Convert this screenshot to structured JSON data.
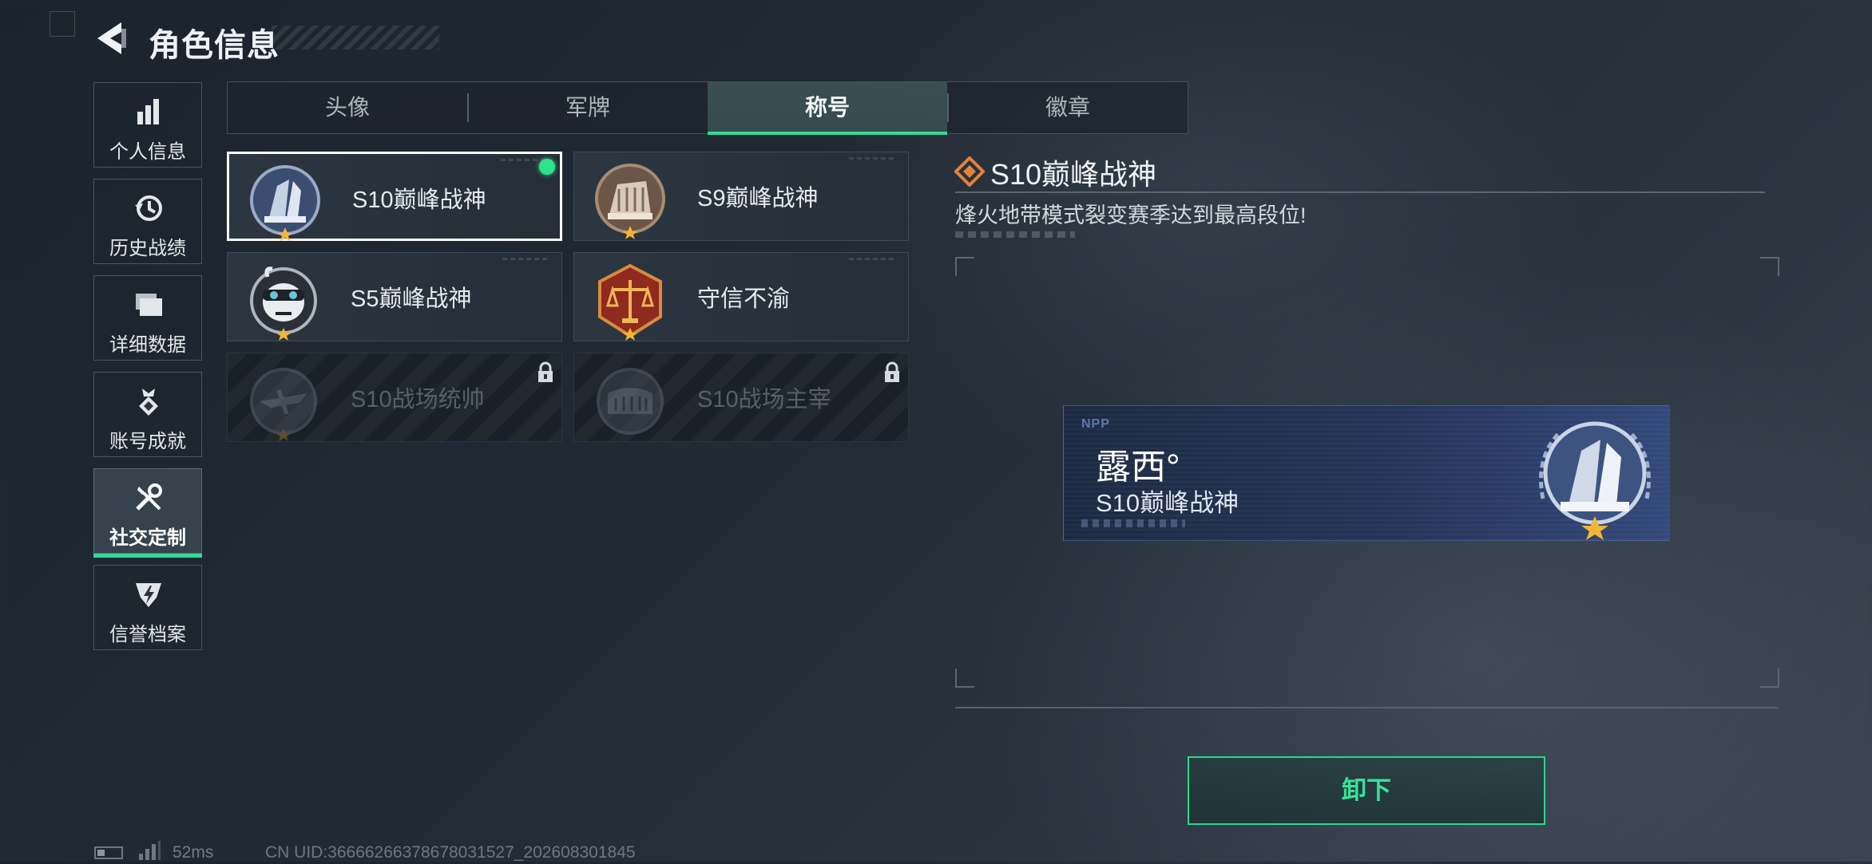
{
  "header": {
    "title": "角色信息"
  },
  "sidebar": {
    "items": [
      {
        "label": "个人信息",
        "icon": "bar-chart-icon"
      },
      {
        "label": "历史战绩",
        "icon": "history-clock-icon"
      },
      {
        "label": "详细数据",
        "icon": "folder-stack-icon"
      },
      {
        "label": "账号成就",
        "icon": "achievement-medal-icon"
      },
      {
        "label": "社交定制",
        "icon": "tools-icon",
        "active": true
      },
      {
        "label": "信誉档案",
        "icon": "credit-shield-icon"
      }
    ]
  },
  "tabs": [
    {
      "label": "头像"
    },
    {
      "label": "军牌"
    },
    {
      "label": "称号",
      "active": true
    },
    {
      "label": "徽章"
    }
  ],
  "titles": [
    {
      "name": "S10巅峰战神",
      "selected": true,
      "equipped": true,
      "locked": false
    },
    {
      "name": "S9巅峰战神",
      "locked": false
    },
    {
      "name": "S5巅峰战神",
      "locked": false
    },
    {
      "name": "守信不渝",
      "locked": false
    },
    {
      "name": "S10战场统帅",
      "locked": true
    },
    {
      "name": "S10战场主宰",
      "locked": true
    }
  ],
  "detail": {
    "title": "S10巅峰战神",
    "description": "烽火地带模式裂变赛季达到最高段位!"
  },
  "nameplate": {
    "tag": "NPP",
    "player_name": "露西°",
    "title": "S10巅峰战神"
  },
  "actions": {
    "unequip_label": "卸下"
  },
  "footer": {
    "ping": "52ms",
    "uid": "CN UID:36666266378678031527_202608301845"
  },
  "colors": {
    "accent": "#34d999",
    "selected_border": "#ffffff",
    "equipped_dot": "#2fe08d"
  }
}
